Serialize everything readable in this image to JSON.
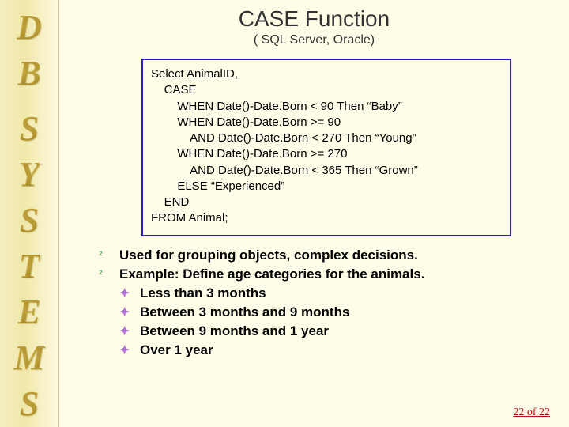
{
  "sidebar": {
    "group1": [
      "D",
      "B"
    ],
    "group2": [
      "S",
      "Y",
      "S",
      "T",
      "E",
      "M",
      "S"
    ]
  },
  "title": "CASE Function",
  "subtitle": "( SQL Server, Oracle)",
  "code": "Select AnimalID,\n    CASE\n        WHEN Date()-Date.Born < 90 Then “Baby”\n        WHEN Date()-Date.Born >= 90\n            AND Date()-Date.Born < 270 Then “Young”\n        WHEN Date()-Date.Born >= 270\n            AND Date()-Date.Born < 365 Then “Grown”\n        ELSE “Experienced”\n    END\nFROM Animal;",
  "bullets_l1": [
    "Used for grouping objects, complex decisions.",
    "Example: Define age categories for the animals."
  ],
  "bullets_l2": [
    "Less than 3 months",
    "Between 3 months and 9 months",
    "Between 9 months and 1 year",
    "Over 1 year"
  ],
  "marks": {
    "l1": "²",
    "l2": "✦"
  },
  "footer": {
    "page": "22",
    "of": " of ",
    "total": "22"
  }
}
